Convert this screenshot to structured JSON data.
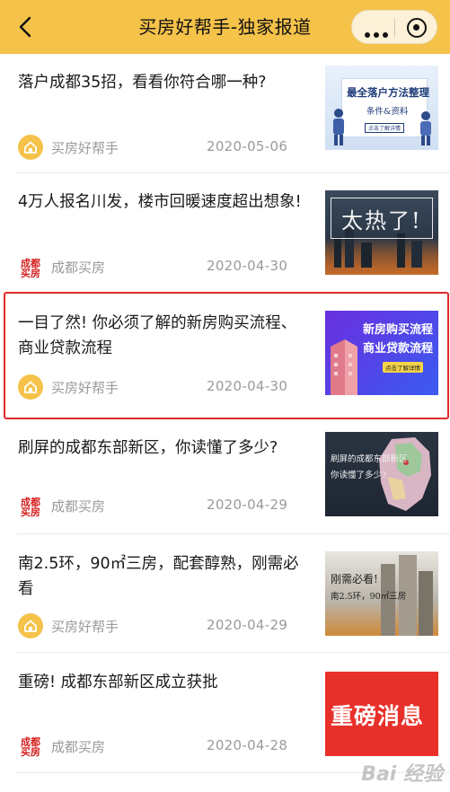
{
  "nav": {
    "title": "买房好帮手-独家报道"
  },
  "articles": [
    {
      "title": "落户成都35招，看看你符合哪一种?",
      "source": "买房好帮手",
      "source_icon": "house-icon",
      "date": "2020-05-06",
      "thumb": {
        "line1": "最全落户方法整理",
        "line2": "条件&资料",
        "line3": "点击了解详情"
      }
    },
    {
      "title": "4万人报名川发，楼市回暖速度超出想象!",
      "source": "成都买房",
      "source_icon": "chengdu-maifang-logo",
      "date": "2020-04-30",
      "thumb": {
        "line1": "太热了!"
      }
    },
    {
      "title": "一目了然! 你必须了解的新房购买流程、商业贷款流程",
      "source": "买房好帮手",
      "source_icon": "house-icon",
      "date": "2020-04-30",
      "thumb": {
        "line1": "新房购买流程",
        "line2": "商业贷款流程",
        "line3": "点击了解详情"
      }
    },
    {
      "title": "刷屏的成都东部新区，你读懂了多少?",
      "source": "成都买房",
      "source_icon": "chengdu-maifang-logo",
      "date": "2020-04-29",
      "thumb": {
        "line1": "刷屏的成都东部新区",
        "line2": "你读懂了多少?"
      }
    },
    {
      "title": "南2.5环，90㎡三房，配套醇熟，刚需必看",
      "source": "买房好帮手",
      "source_icon": "house-icon",
      "date": "2020-04-29",
      "thumb": {
        "line1": "刚需必看!",
        "line2": "南2.5环，90㎡三房"
      }
    },
    {
      "title": "重磅! 成都东部新区成立获批",
      "source": "成都买房",
      "source_icon": "chengdu-maifang-logo",
      "date": "2020-04-28",
      "thumb": {
        "line1": "重磅消息"
      }
    }
  ],
  "logo_text": {
    "top": "成都",
    "bottom": "买房"
  },
  "watermark": "Bai 经验",
  "colors": {
    "nav_bg": "#f5c24a",
    "highlight": "#e02a2a",
    "meta_text": "#9a9a9a"
  }
}
